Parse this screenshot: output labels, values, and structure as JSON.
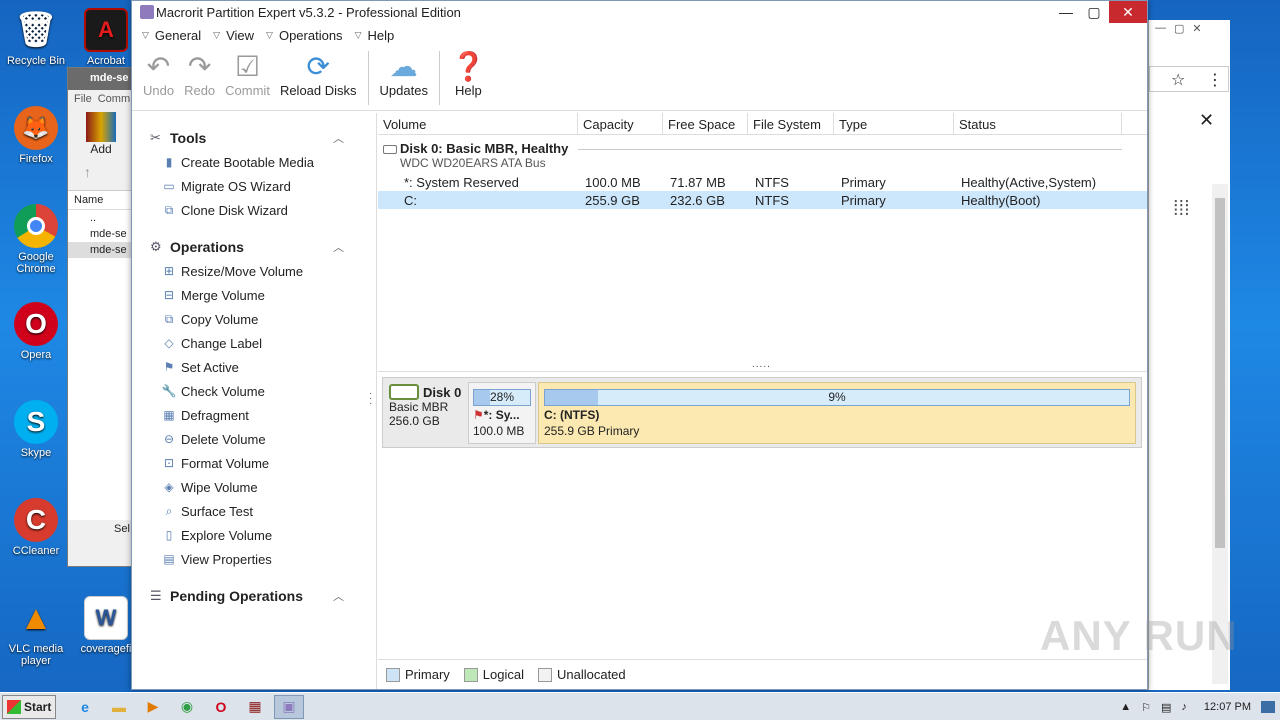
{
  "desktop": {
    "icons": [
      {
        "label": "Recycle Bin",
        "color": "#8aa9c9",
        "glyph": "🗑"
      },
      {
        "label": "Firefox",
        "color": "#e8641b",
        "glyph": "🦊"
      },
      {
        "label": "Google Chrome",
        "color": "#2f9e44",
        "glyph": "◉"
      },
      {
        "label": "Opera",
        "color": "#d0021b",
        "glyph": "O"
      },
      {
        "label": "Skype",
        "color": "#00aff0",
        "glyph": "S"
      },
      {
        "label": "CCleaner",
        "color": "#d63b2e",
        "glyph": "C"
      },
      {
        "label": "VLC media player",
        "color": "#f08a00",
        "glyph": "▲"
      },
      {
        "label": "coveragefi",
        "color": "#2b5797",
        "glyph": "W"
      },
      {
        "label": "Acrobat",
        "color": "#b30b00",
        "glyph": "A"
      }
    ]
  },
  "winrar": {
    "title": "mde-se",
    "menu": [
      "File",
      "Comm"
    ],
    "add_label": "Add",
    "col_name": "Name",
    "rows": [
      "..",
      "mde-se",
      "mde-se"
    ],
    "status": "Sel"
  },
  "app": {
    "title": "Macrorit Partition Expert v5.3.2 - Professional Edition",
    "menu": [
      "General",
      "View",
      "Operations",
      "Help"
    ],
    "toolbar": {
      "undo": "Undo",
      "redo": "Redo",
      "commit": "Commit",
      "reload": "Reload Disks",
      "updates": "Updates",
      "help": "Help"
    },
    "tools": {
      "header": "Tools",
      "items": [
        "Create Bootable Media",
        "Migrate OS Wizard",
        "Clone Disk Wizard"
      ]
    },
    "operations": {
      "header": "Operations",
      "items": [
        "Resize/Move Volume",
        "Merge Volume",
        "Copy Volume",
        "Change Label",
        "Set Active",
        "Check Volume",
        "Defragment",
        "Delete Volume",
        "Format Volume",
        "Wipe Volume",
        "Surface Test",
        "Explore Volume",
        "View Properties"
      ]
    },
    "pending": {
      "header": "Pending Operations"
    },
    "columns": [
      "Volume",
      "Capacity",
      "Free Space",
      "File System",
      "Type",
      "Status"
    ],
    "disk": {
      "title": "Disk 0: Basic MBR, Healthy",
      "subtitle": "WDC WD20EARS ATA Bus"
    },
    "partitions": [
      {
        "volume": "*: System Reserved",
        "capacity": "100.0 MB",
        "free": "71.87 MB",
        "fs": "NTFS",
        "type": "Primary",
        "status": "Healthy(Active,System)"
      },
      {
        "volume": "C:",
        "capacity": "255.9 GB",
        "free": "232.6 GB",
        "fs": "NTFS",
        "type": "Primary",
        "status": "Healthy(Boot)"
      }
    ],
    "splitter_dots": ".....",
    "diskmap": {
      "name": "Disk 0",
      "kind": "Basic MBR",
      "size": "256.0 GB",
      "p1": {
        "pct_label": "28%",
        "used_fraction": 0.28,
        "name": "*: Sy...",
        "size": "100.0 MB"
      },
      "p2": {
        "pct_label": "9%",
        "used_fraction": 0.09,
        "name": "C: (NTFS)",
        "size": "255.9 GB Primary"
      }
    },
    "legend": [
      {
        "label": "Primary",
        "color": "#cfe3f7"
      },
      {
        "label": "Logical",
        "color": "#bfe8b8"
      },
      {
        "label": "Unallocated",
        "color": "#f2f2f2"
      }
    ]
  },
  "taskbar": {
    "start": "Start",
    "time": "12:07 PM"
  },
  "watermark": "ANY RUN"
}
